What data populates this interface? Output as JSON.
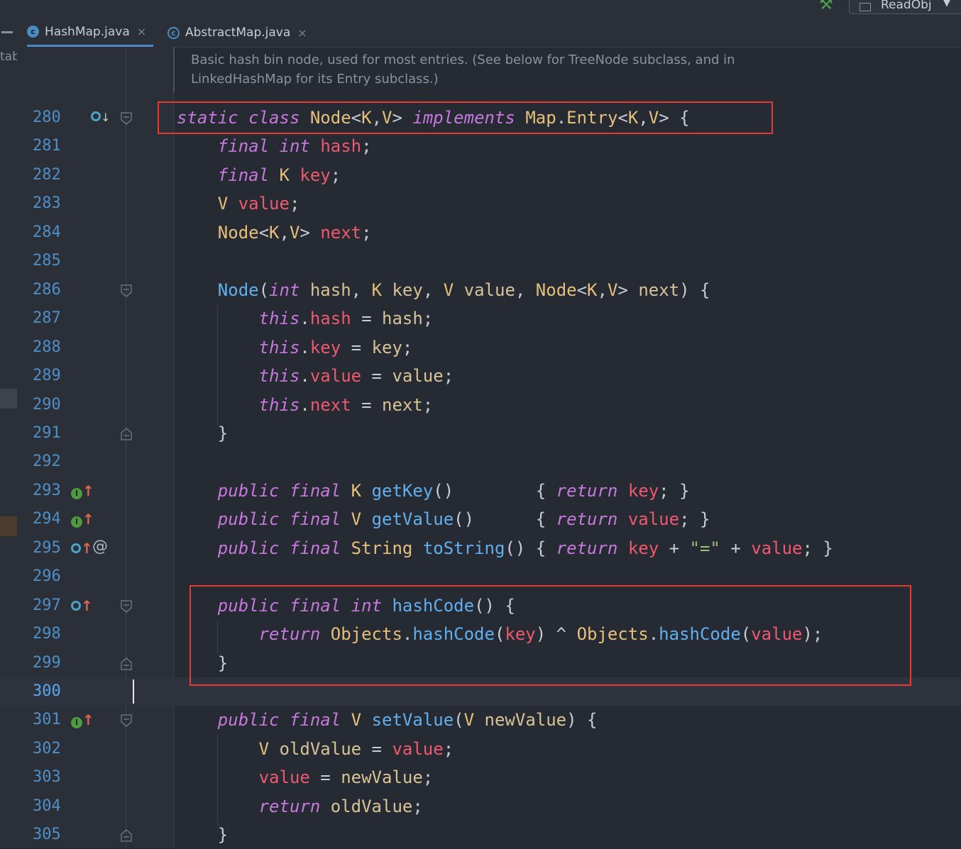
{
  "run_config": {
    "name": "ReadObj",
    "arrow": "▼",
    "run_icon": "hammer-icon"
  },
  "tabs": [
    {
      "name": "HashMap.java",
      "icon": "class-icon",
      "icon_letter": "c",
      "active": true,
      "close": "×"
    },
    {
      "name": "AbstractMap.java",
      "icon": "abstract-class-icon",
      "icon_letter": "c",
      "active": false,
      "close": "×"
    }
  ],
  "left_panel_text": "tab",
  "doc_comment": [
    "Basic hash bin node, used for most entries. (See below for TreeNode subclass, and in",
    "LinkedHashMap for its Entry subclass.)"
  ],
  "lines": [
    {
      "no": "280",
      "tokens": [
        [
          "static",
          "kw"
        ],
        [
          " ",
          "pl"
        ],
        [
          "class",
          "kw"
        ],
        [
          " ",
          "pl"
        ],
        [
          "Node",
          "typ"
        ],
        [
          "<",
          "pl"
        ],
        [
          "K",
          "typ"
        ],
        [
          ",",
          "pl"
        ],
        [
          "V",
          "typ"
        ],
        [
          "> ",
          "pl"
        ],
        [
          "implements",
          "kw"
        ],
        [
          " ",
          "pl"
        ],
        [
          "Map",
          "typ"
        ],
        [
          ".",
          "pl"
        ],
        [
          "Entry",
          "typ"
        ],
        [
          "<",
          "pl"
        ],
        [
          "K",
          "typ"
        ],
        [
          ",",
          "pl"
        ],
        [
          "V",
          "typ"
        ],
        [
          "> {",
          "pl"
        ]
      ]
    },
    {
      "no": "281",
      "tokens": [
        [
          "    ",
          "pl"
        ],
        [
          "final",
          "kw"
        ],
        [
          " ",
          "pl"
        ],
        [
          "int",
          "kw"
        ],
        [
          " ",
          "pl"
        ],
        [
          "hash",
          "fld"
        ],
        [
          ";",
          "pl"
        ]
      ]
    },
    {
      "no": "282",
      "tokens": [
        [
          "    ",
          "pl"
        ],
        [
          "final",
          "kw"
        ],
        [
          " ",
          "pl"
        ],
        [
          "K",
          "typ"
        ],
        [
          " ",
          "pl"
        ],
        [
          "key",
          "fld"
        ],
        [
          ";",
          "pl"
        ]
      ]
    },
    {
      "no": "283",
      "tokens": [
        [
          "    ",
          "pl"
        ],
        [
          "V",
          "typ"
        ],
        [
          " ",
          "pl"
        ],
        [
          "value",
          "fld"
        ],
        [
          ";",
          "pl"
        ]
      ]
    },
    {
      "no": "284",
      "tokens": [
        [
          "    ",
          "pl"
        ],
        [
          "Node",
          "typ"
        ],
        [
          "<",
          "pl"
        ],
        [
          "K",
          "typ"
        ],
        [
          ",",
          "pl"
        ],
        [
          "V",
          "typ"
        ],
        [
          "> ",
          "pl"
        ],
        [
          "next",
          "fld"
        ],
        [
          ";",
          "pl"
        ]
      ]
    },
    {
      "no": "285",
      "tokens": []
    },
    {
      "no": "286",
      "tokens": [
        [
          "    ",
          "pl"
        ],
        [
          "Node",
          "fn"
        ],
        [
          "(",
          "pl"
        ],
        [
          "int",
          "kw"
        ],
        [
          " ",
          "pl"
        ],
        [
          "hash",
          "prm"
        ],
        [
          ", ",
          "pl"
        ],
        [
          "K",
          "typ"
        ],
        [
          " ",
          "pl"
        ],
        [
          "key",
          "prm"
        ],
        [
          ", ",
          "pl"
        ],
        [
          "V",
          "typ"
        ],
        [
          " ",
          "pl"
        ],
        [
          "value",
          "prm"
        ],
        [
          ", ",
          "pl"
        ],
        [
          "Node",
          "typ"
        ],
        [
          "<",
          "pl"
        ],
        [
          "K",
          "typ"
        ],
        [
          ",",
          "pl"
        ],
        [
          "V",
          "typ"
        ],
        [
          "> ",
          "pl"
        ],
        [
          "next",
          "prm"
        ],
        [
          ") {",
          "pl"
        ]
      ]
    },
    {
      "no": "287",
      "tokens": [
        [
          "        ",
          "pl"
        ],
        [
          "this",
          "kw"
        ],
        [
          ".",
          "pl"
        ],
        [
          "hash",
          "fld"
        ],
        [
          " = ",
          "pl"
        ],
        [
          "hash",
          "prm"
        ],
        [
          ";",
          "pl"
        ]
      ]
    },
    {
      "no": "288",
      "tokens": [
        [
          "        ",
          "pl"
        ],
        [
          "this",
          "kw"
        ],
        [
          ".",
          "pl"
        ],
        [
          "key",
          "fld"
        ],
        [
          " = ",
          "pl"
        ],
        [
          "key",
          "prm"
        ],
        [
          ";",
          "pl"
        ]
      ]
    },
    {
      "no": "289",
      "tokens": [
        [
          "        ",
          "pl"
        ],
        [
          "this",
          "kw"
        ],
        [
          ".",
          "pl"
        ],
        [
          "value",
          "fld"
        ],
        [
          " = ",
          "pl"
        ],
        [
          "value",
          "prm"
        ],
        [
          ";",
          "pl"
        ]
      ]
    },
    {
      "no": "290",
      "tokens": [
        [
          "        ",
          "pl"
        ],
        [
          "this",
          "kw"
        ],
        [
          ".",
          "pl"
        ],
        [
          "next",
          "fld"
        ],
        [
          " = ",
          "pl"
        ],
        [
          "next",
          "prm"
        ],
        [
          ";",
          "pl"
        ]
      ]
    },
    {
      "no": "291",
      "tokens": [
        [
          "    }",
          "pl"
        ]
      ]
    },
    {
      "no": "292",
      "tokens": []
    },
    {
      "no": "293",
      "tokens": [
        [
          "    ",
          "pl"
        ],
        [
          "public",
          "kw"
        ],
        [
          " ",
          "pl"
        ],
        [
          "final",
          "kw"
        ],
        [
          " ",
          "pl"
        ],
        [
          "K",
          "typ"
        ],
        [
          " ",
          "pl"
        ],
        [
          "getKey",
          "fn"
        ],
        [
          "()        { ",
          "pl"
        ],
        [
          "return",
          "kw"
        ],
        [
          " ",
          "pl"
        ],
        [
          "key",
          "fld"
        ],
        [
          "; }",
          "pl"
        ]
      ]
    },
    {
      "no": "294",
      "tokens": [
        [
          "    ",
          "pl"
        ],
        [
          "public",
          "kw"
        ],
        [
          " ",
          "pl"
        ],
        [
          "final",
          "kw"
        ],
        [
          " ",
          "pl"
        ],
        [
          "V",
          "typ"
        ],
        [
          " ",
          "pl"
        ],
        [
          "getValue",
          "fn"
        ],
        [
          "()      { ",
          "pl"
        ],
        [
          "return",
          "kw"
        ],
        [
          " ",
          "pl"
        ],
        [
          "value",
          "fld"
        ],
        [
          "; }",
          "pl"
        ]
      ]
    },
    {
      "no": "295",
      "tokens": [
        [
          "    ",
          "pl"
        ],
        [
          "public",
          "kw"
        ],
        [
          " ",
          "pl"
        ],
        [
          "final",
          "kw"
        ],
        [
          " ",
          "pl"
        ],
        [
          "String",
          "typ"
        ],
        [
          " ",
          "pl"
        ],
        [
          "toString",
          "fn"
        ],
        [
          "() { ",
          "pl"
        ],
        [
          "return",
          "kw"
        ],
        [
          " ",
          "pl"
        ],
        [
          "key",
          "fld"
        ],
        [
          " + ",
          "pl"
        ],
        [
          "\"=\"",
          "str"
        ],
        [
          " + ",
          "pl"
        ],
        [
          "value",
          "fld"
        ],
        [
          "; }",
          "pl"
        ]
      ]
    },
    {
      "no": "296",
      "tokens": []
    },
    {
      "no": "297",
      "tokens": [
        [
          "    ",
          "pl"
        ],
        [
          "public",
          "kw"
        ],
        [
          " ",
          "pl"
        ],
        [
          "final",
          "kw"
        ],
        [
          " ",
          "pl"
        ],
        [
          "int",
          "kw"
        ],
        [
          " ",
          "pl"
        ],
        [
          "hashCode",
          "fn"
        ],
        [
          "() {",
          "pl"
        ]
      ]
    },
    {
      "no": "298",
      "tokens": [
        [
          "        ",
          "pl"
        ],
        [
          "return",
          "kw"
        ],
        [
          " ",
          "pl"
        ],
        [
          "Objects",
          "typ"
        ],
        [
          ".",
          "pl"
        ],
        [
          "hashCode",
          "fn"
        ],
        [
          "(",
          "pl"
        ],
        [
          "key",
          "fld"
        ],
        [
          ") ^ ",
          "pl"
        ],
        [
          "Objects",
          "typ"
        ],
        [
          ".",
          "pl"
        ],
        [
          "hashCode",
          "fn"
        ],
        [
          "(",
          "pl"
        ],
        [
          "value",
          "fld"
        ],
        [
          ");",
          "pl"
        ]
      ]
    },
    {
      "no": "299",
      "tokens": [
        [
          "    }",
          "pl"
        ]
      ]
    },
    {
      "no": "300",
      "tokens": [],
      "current": true
    },
    {
      "no": "301",
      "tokens": [
        [
          "    ",
          "pl"
        ],
        [
          "public",
          "kw"
        ],
        [
          " ",
          "pl"
        ],
        [
          "final",
          "kw"
        ],
        [
          " ",
          "pl"
        ],
        [
          "V",
          "typ"
        ],
        [
          " ",
          "pl"
        ],
        [
          "setValue",
          "fn"
        ],
        [
          "(",
          "pl"
        ],
        [
          "V",
          "typ"
        ],
        [
          " ",
          "pl"
        ],
        [
          "newValue",
          "prm"
        ],
        [
          ") {",
          "pl"
        ]
      ]
    },
    {
      "no": "302",
      "tokens": [
        [
          "        ",
          "pl"
        ],
        [
          "V",
          "typ"
        ],
        [
          " ",
          "pl"
        ],
        [
          "oldValue",
          "prm"
        ],
        [
          " = ",
          "pl"
        ],
        [
          "value",
          "fld"
        ],
        [
          ";",
          "pl"
        ]
      ]
    },
    {
      "no": "303",
      "tokens": [
        [
          "        ",
          "pl"
        ],
        [
          "value",
          "fld"
        ],
        [
          " = ",
          "pl"
        ],
        [
          "newValue",
          "prm"
        ],
        [
          ";",
          "pl"
        ]
      ]
    },
    {
      "no": "304",
      "tokens": [
        [
          "        ",
          "pl"
        ],
        [
          "return",
          "kw"
        ],
        [
          " ",
          "pl"
        ],
        [
          "oldValue",
          "prm"
        ],
        [
          ";",
          "pl"
        ]
      ]
    },
    {
      "no": "305",
      "tokens": [
        [
          "    }",
          "pl"
        ]
      ]
    }
  ],
  "gutter_icons": {
    "280": [
      "implemented-down-icon"
    ],
    "293": [
      "interface-implements-up-icon"
    ],
    "294": [
      "interface-implements-up-icon"
    ],
    "295": [
      "overrides-up-icon",
      "annotation-icon"
    ],
    "297": [
      "overrides-up-icon"
    ],
    "301": [
      "interface-implements-up-icon"
    ]
  },
  "gutter_glyphs": {
    "letter_i": "I",
    "arrow_up": "↑",
    "arrow_down": "↓",
    "at": "@"
  },
  "fold_markers": {
    "280": "open",
    "286": "open",
    "291": "close",
    "297": "open",
    "299": "close",
    "301": "open",
    "305": "close"
  },
  "highlight_colors": {
    "box": "#e53935",
    "keyword": "#c678dd",
    "type": "#e5c07b",
    "field": "#ef596f",
    "method": "#61afef"
  }
}
